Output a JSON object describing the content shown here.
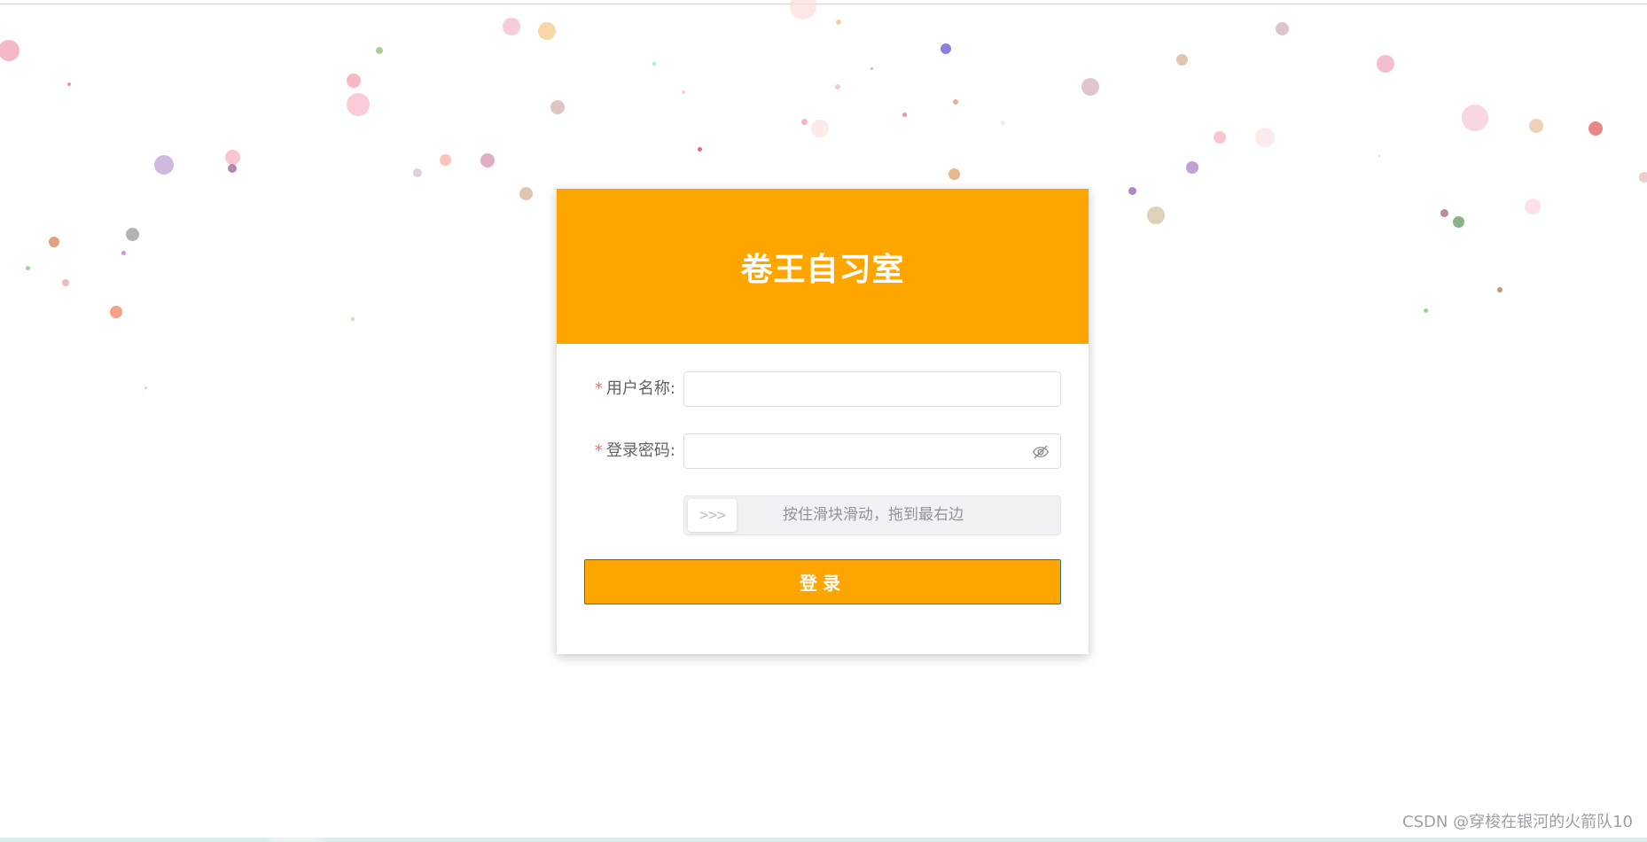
{
  "app": {
    "title": "卷王自习室"
  },
  "colors": {
    "accent": "#ffa500",
    "required": "#f56c6c",
    "label": "#606266",
    "placeholder": "#909399"
  },
  "form": {
    "username": {
      "required_mark": "*",
      "label": "用户名称:",
      "value": "",
      "placeholder": ""
    },
    "password": {
      "required_mark": "*",
      "label": "登录密码:",
      "value": "",
      "placeholder": "",
      "toggle_icon": "eye-off-icon"
    },
    "slider": {
      "handle_text": ">>>",
      "hint": "按住滑块滑动，拖到最右边",
      "progress": 0
    },
    "submit_label": "登录"
  },
  "watermark": "CSDN @穿梭在银河的火箭队10"
}
